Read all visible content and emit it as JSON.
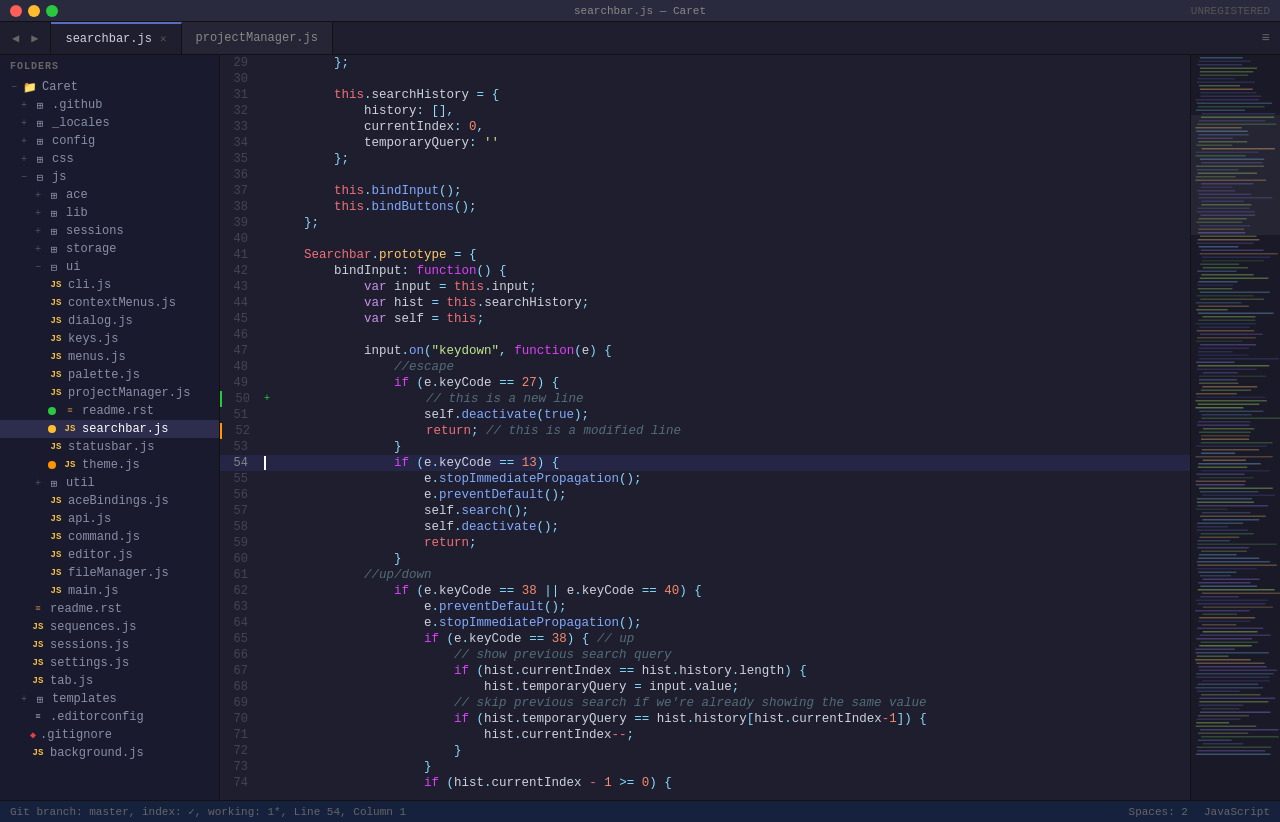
{
  "titlebar": {
    "title": "searchbar.js — Caret",
    "unregistered": "UNREGISTERED"
  },
  "tabs": [
    {
      "id": "searchbar",
      "label": "searchbar.js",
      "active": true,
      "closeable": true
    },
    {
      "id": "projectManager",
      "label": "projectManager.js",
      "active": false,
      "closeable": false
    }
  ],
  "sidebar": {
    "section_label": "FOLDERS",
    "root": "Caret",
    "items": [
      {
        "indent": 1,
        "type": "folder",
        "label": ".github",
        "expanded": false,
        "toggle": "+"
      },
      {
        "indent": 1,
        "type": "folder",
        "label": "_locales",
        "expanded": false,
        "toggle": "+"
      },
      {
        "indent": 1,
        "type": "folder",
        "label": "config",
        "expanded": false,
        "toggle": "+"
      },
      {
        "indent": 1,
        "type": "folder",
        "label": "css",
        "expanded": false,
        "toggle": "+"
      },
      {
        "indent": 1,
        "type": "folder",
        "label": "js",
        "expanded": true,
        "toggle": "−"
      },
      {
        "indent": 2,
        "type": "folder",
        "label": "ace",
        "expanded": false,
        "toggle": "+"
      },
      {
        "indent": 2,
        "type": "folder",
        "label": "lib",
        "expanded": false,
        "toggle": "+"
      },
      {
        "indent": 2,
        "type": "folder",
        "label": "sessions",
        "expanded": false,
        "toggle": "+"
      },
      {
        "indent": 2,
        "type": "folder",
        "label": "storage",
        "expanded": false,
        "toggle": "+"
      },
      {
        "indent": 2,
        "type": "folder",
        "label": "ui",
        "expanded": true,
        "toggle": "−"
      },
      {
        "indent": 3,
        "type": "js",
        "label": "cli.js",
        "dot": "none"
      },
      {
        "indent": 3,
        "type": "js",
        "label": "contextMenus.js",
        "dot": "none"
      },
      {
        "indent": 3,
        "type": "js",
        "label": "dialog.js",
        "dot": "none"
      },
      {
        "indent": 3,
        "type": "js",
        "label": "keys.js",
        "dot": "none"
      },
      {
        "indent": 3,
        "type": "js",
        "label": "menus.js",
        "dot": "none"
      },
      {
        "indent": 3,
        "type": "js",
        "label": "palette.js",
        "dot": "none"
      },
      {
        "indent": 3,
        "type": "js",
        "label": "projectManager.js",
        "dot": "none"
      },
      {
        "indent": 3,
        "type": "rst",
        "label": "readme.rst",
        "dot": "green"
      },
      {
        "indent": 3,
        "type": "js",
        "label": "searchbar.js",
        "dot": "yellow",
        "active": true
      },
      {
        "indent": 3,
        "type": "js",
        "label": "statusbar.js",
        "dot": "none"
      },
      {
        "indent": 3,
        "type": "js",
        "label": "theme.js",
        "dot": "orange"
      },
      {
        "indent": 2,
        "type": "folder",
        "label": "util",
        "expanded": false,
        "toggle": "+"
      },
      {
        "indent": 3,
        "type": "js",
        "label": "aceBindings.js",
        "dot": "none"
      },
      {
        "indent": 3,
        "type": "js",
        "label": "api.js",
        "dot": "none"
      },
      {
        "indent": 3,
        "type": "js",
        "label": "command.js",
        "dot": "none"
      },
      {
        "indent": 3,
        "type": "js",
        "label": "editor.js",
        "dot": "none"
      },
      {
        "indent": 3,
        "type": "js",
        "label": "fileManager.js",
        "dot": "none"
      },
      {
        "indent": 3,
        "type": "js",
        "label": "main.js",
        "dot": "none"
      },
      {
        "indent": 2,
        "type": "rst",
        "label": "readme.rst",
        "dot": "none"
      },
      {
        "indent": 2,
        "type": "js",
        "label": "sequences.js",
        "dot": "none"
      },
      {
        "indent": 2,
        "type": "js",
        "label": "sessions.js",
        "dot": "none"
      },
      {
        "indent": 2,
        "type": "js",
        "label": "settings.js",
        "dot": "none"
      },
      {
        "indent": 2,
        "type": "js",
        "label": "tab.js",
        "dot": "none"
      },
      {
        "indent": 1,
        "type": "folder",
        "label": "templates",
        "expanded": false,
        "toggle": "+"
      },
      {
        "indent": 2,
        "type": "cfg",
        "label": ".editorconfig",
        "dot": "none"
      },
      {
        "indent": 2,
        "type": "git",
        "label": ".gitignore",
        "dot": "none"
      },
      {
        "indent": 2,
        "type": "js",
        "label": "background.js",
        "dot": "none"
      }
    ]
  },
  "code_lines": [
    {
      "num": 29,
      "content": "        };",
      "indicator": "",
      "highlight": false
    },
    {
      "num": 30,
      "content": "",
      "indicator": "",
      "highlight": false
    },
    {
      "num": 31,
      "content": "        this.searchHistory = {",
      "indicator": "",
      "highlight": false
    },
    {
      "num": 32,
      "content": "            history: [],",
      "indicator": "",
      "highlight": false
    },
    {
      "num": 33,
      "content": "            currentIndex: 0,",
      "indicator": "",
      "highlight": false
    },
    {
      "num": 34,
      "content": "            temporaryQuery: ''",
      "indicator": "",
      "highlight": false
    },
    {
      "num": 35,
      "content": "        };",
      "indicator": "",
      "highlight": false
    },
    {
      "num": 36,
      "content": "",
      "indicator": "",
      "highlight": false
    },
    {
      "num": 37,
      "content": "        this.bindInput();",
      "indicator": "",
      "highlight": false
    },
    {
      "num": 38,
      "content": "        this.bindButtons();",
      "indicator": "",
      "highlight": false
    },
    {
      "num": 39,
      "content": "    };",
      "indicator": "",
      "highlight": false
    },
    {
      "num": 40,
      "content": "",
      "indicator": "",
      "highlight": false
    },
    {
      "num": 41,
      "content": "    Searchbar.prototype = {",
      "indicator": "",
      "highlight": false
    },
    {
      "num": 42,
      "content": "        bindInput: function() {",
      "indicator": "",
      "highlight": false
    },
    {
      "num": 43,
      "content": "            var input = this.input;",
      "indicator": "",
      "highlight": false
    },
    {
      "num": 44,
      "content": "            var hist = this.searchHistory;",
      "indicator": "",
      "highlight": false
    },
    {
      "num": 45,
      "content": "            var self = this;",
      "indicator": "",
      "highlight": false
    },
    {
      "num": 46,
      "content": "",
      "indicator": "",
      "highlight": false
    },
    {
      "num": 47,
      "content": "            input.on(\"keydown\", function(e) {",
      "indicator": "",
      "highlight": false
    },
    {
      "num": 48,
      "content": "                //escape",
      "indicator": "",
      "highlight": false
    },
    {
      "num": 49,
      "content": "                if (e.keyCode == 27) {",
      "indicator": "",
      "highlight": false
    },
    {
      "num": 50,
      "content": "                    // this is a new line",
      "indicator": "green",
      "highlight": false
    },
    {
      "num": 51,
      "content": "                    self.deactivate(true);",
      "indicator": "",
      "highlight": false
    },
    {
      "num": 52,
      "content": "                    return; // this is a modified line",
      "indicator": "orange",
      "highlight": false
    },
    {
      "num": 53,
      "content": "                }",
      "indicator": "",
      "highlight": false
    },
    {
      "num": 54,
      "content": "                if (e.keyCode == 13) {",
      "indicator": "cursor",
      "highlight": true
    },
    {
      "num": 55,
      "content": "                    e.stopImmediatePropagation();",
      "indicator": "",
      "highlight": false
    },
    {
      "num": 56,
      "content": "                    e.preventDefault();",
      "indicator": "",
      "highlight": false
    },
    {
      "num": 57,
      "content": "                    self.search();",
      "indicator": "",
      "highlight": false
    },
    {
      "num": 58,
      "content": "                    self.deactivate();",
      "indicator": "",
      "highlight": false
    },
    {
      "num": 59,
      "content": "                    return;",
      "indicator": "",
      "highlight": false
    },
    {
      "num": 60,
      "content": "                }",
      "indicator": "",
      "highlight": false
    },
    {
      "num": 61,
      "content": "            //up/down",
      "indicator": "",
      "highlight": false
    },
    {
      "num": 62,
      "content": "                if (e.keyCode == 38 || e.keyCode == 40) {",
      "indicator": "",
      "highlight": false
    },
    {
      "num": 63,
      "content": "                    e.preventDefault();",
      "indicator": "",
      "highlight": false
    },
    {
      "num": 64,
      "content": "                    e.stopImmediatePropagation();",
      "indicator": "",
      "highlight": false
    },
    {
      "num": 65,
      "content": "                    if (e.keyCode == 38) { // up",
      "indicator": "",
      "highlight": false
    },
    {
      "num": 66,
      "content": "                        // show previous search query",
      "indicator": "",
      "highlight": false
    },
    {
      "num": 67,
      "content": "                        if (hist.currentIndex == hist.history.length) {",
      "indicator": "",
      "highlight": false
    },
    {
      "num": 68,
      "content": "                            hist.temporaryQuery = input.value;",
      "indicator": "",
      "highlight": false
    },
    {
      "num": 69,
      "content": "                        // skip previous search if we're already showing the same value",
      "indicator": "",
      "highlight": false
    },
    {
      "num": 70,
      "content": "                        if (hist.temporaryQuery == hist.history[hist.currentIndex-1]) {",
      "indicator": "",
      "highlight": false
    },
    {
      "num": 71,
      "content": "                            hist.currentIndex--;",
      "indicator": "",
      "highlight": false
    },
    {
      "num": 72,
      "content": "                        }",
      "indicator": "",
      "highlight": false
    },
    {
      "num": 73,
      "content": "                    }",
      "indicator": "",
      "highlight": false
    },
    {
      "num": 74,
      "content": "                if (hist.currentIndex - 1 >= 0) {",
      "indicator": "",
      "highlight": false
    }
  ],
  "statusbar": {
    "branch_info": "Git branch: master, index: ✓, working: 1*, Line 54, Column 1",
    "spaces": "Spaces: 2",
    "language": "JavaScript"
  }
}
